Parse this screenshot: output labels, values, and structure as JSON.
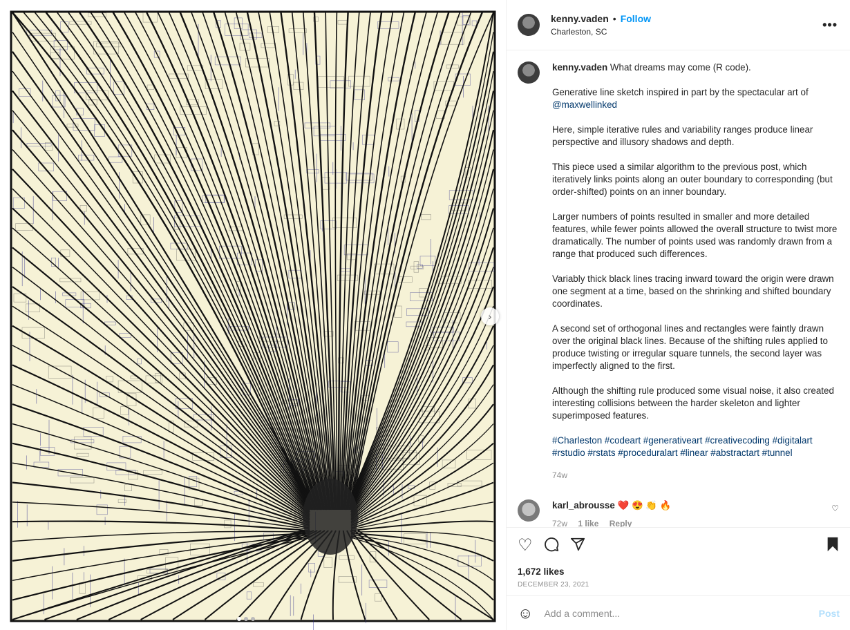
{
  "post": {
    "username": "kenny.vaden",
    "separator": "•",
    "follow_label": "Follow",
    "location": "Charleston, SC",
    "more_icon": "more-options-icon"
  },
  "caption": {
    "username": "kenny.vaden",
    "title": "What dreams may come (R code).",
    "p1_text": "Generative line sketch inspired in part by the spectacular art of",
    "p1_mention": "@maxwellinked",
    "p2": "Here, simple iterative rules and variability ranges produce linear perspective and illusory shadows and depth.",
    "p3": "This piece used a similar algorithm to the previous post, which iteratively links points along an outer boundary to corresponding (but order-shifted) points on an inner boundary.",
    "p4": "Larger numbers of points resulted in smaller and more detailed features, while fewer points allowed the overall structure to twist more dramatically. The number of points used was randomly drawn from a range that produced such differences.",
    "p5": "Variably thick black lines tracing inward toward the origin were drawn one segment at a time, based on the shrinking and shifted boundary coordinates.",
    "p6": "A second set of orthogonal lines and rectangles were faintly drawn over the original black lines. Because of the shifting rules applied to produce twisting or irregular square tunnels, the second layer was imperfectly aligned to the first.",
    "p7": "Although the shifting rule produced some visual noise, it also created interesting collisions between the harder skeleton and lighter superimposed features.",
    "hashtags": "#Charleston #codeart #generativeart #creativecoding #digitalart #rstudio #rstats #proceduralart #linear #abstractart #tunnel",
    "time": "74w"
  },
  "comment": {
    "username": "karl_abrousse",
    "text": "❤️ 😍 👏 🔥",
    "time": "72w",
    "likes": "1 like",
    "reply": "Reply"
  },
  "actions": {
    "likes": "1,672 likes",
    "date": "DECEMBER 23, 2021"
  },
  "compose": {
    "placeholder": "Add a comment...",
    "post_label": "Post"
  },
  "colors": {
    "accent": "#0095f6",
    "link": "#00376b",
    "artwork_bg": "#f6f2d6"
  }
}
